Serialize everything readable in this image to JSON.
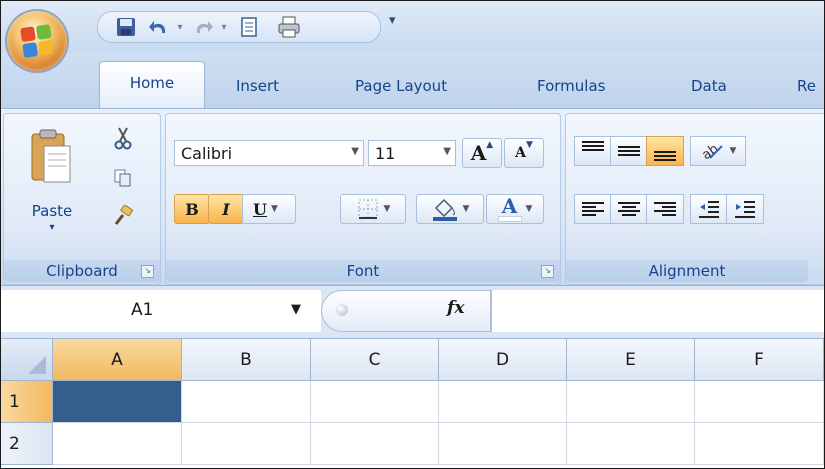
{
  "tabs": [
    "Home",
    "Insert",
    "Page Layout",
    "Formulas",
    "Data",
    "Re"
  ],
  "clipboard": {
    "paste_label": "Paste",
    "group_label": "Clipboard"
  },
  "font": {
    "name_value": "Calibri",
    "size_value": "11",
    "grow_label": "A",
    "shrink_label": "A",
    "bold_label": "B",
    "italic_label": "I",
    "underline_label": "U",
    "color_label": "A",
    "group_label": "Font"
  },
  "alignment": {
    "group_label": "Alignment"
  },
  "formula_bar": {
    "name_box_value": "A1",
    "fx_label": "fx"
  },
  "grid": {
    "columns": [
      "A",
      "B",
      "C",
      "D",
      "E",
      "F"
    ],
    "rows": [
      "1",
      "2"
    ],
    "active_cell": "A1"
  },
  "colors": {
    "ribbon_blue": "#dbe7f7",
    "active_cell": "#355e8d",
    "highlight_orange": "#f9b44c",
    "text_blue": "#15428b"
  },
  "icons": [
    "office-button-icon",
    "save-icon",
    "undo-icon",
    "redo-icon",
    "print-preview-icon",
    "quick-print-icon",
    "customize-qat-icon",
    "paste-icon",
    "cut-icon",
    "copy-icon",
    "format-painter-icon",
    "borders-icon",
    "fill-color-icon",
    "font-color-icon",
    "align-top-icon",
    "align-middle-icon",
    "align-bottom-icon",
    "orientation-icon",
    "align-left-icon",
    "center-icon",
    "align-right-icon",
    "decrease-indent-icon",
    "increase-indent-icon"
  ]
}
